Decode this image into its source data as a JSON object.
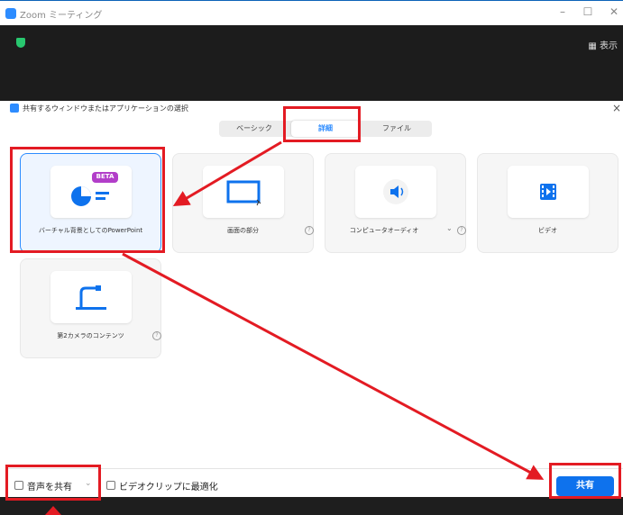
{
  "window": {
    "title": "Zoom ミーティング",
    "minimize": "–",
    "maximize": "☐",
    "close": "✕"
  },
  "meeting": {
    "view_button": "▦ 表示"
  },
  "dialog": {
    "title": "共有するウィンドウまたはアプリケーションの選択",
    "close": "×",
    "tabs": [
      {
        "label": "ベーシック",
        "active": false
      },
      {
        "label": "詳細",
        "active": true
      },
      {
        "label": "ファイル",
        "active": false
      }
    ],
    "options": [
      {
        "label": "バーチャル背景としてのPowerPoint",
        "badge": "BETA",
        "icon": "powerpoint-chart-icon",
        "selected": true
      },
      {
        "label": "画面の部分",
        "icon": "screen-portion-icon",
        "help": "?"
      },
      {
        "label": "コンピュータオーディオ",
        "dropdown": "⌄",
        "icon": "speaker-icon",
        "help": "?"
      },
      {
        "label": "ビデオ",
        "icon": "film-icon"
      },
      {
        "label": "第2カメラのコンテンツ",
        "icon": "document-camera-icon",
        "help": "?"
      }
    ],
    "footer": {
      "share_sound_label": "音声を共有",
      "share_sound_dropdown": "⌄",
      "optimize_label": "ビデオクリップに最適化",
      "share_button": "共有"
    }
  },
  "colors": {
    "accent": "#0e72ed",
    "highlight": "#e31b23",
    "dark": "#1c1c1c"
  }
}
